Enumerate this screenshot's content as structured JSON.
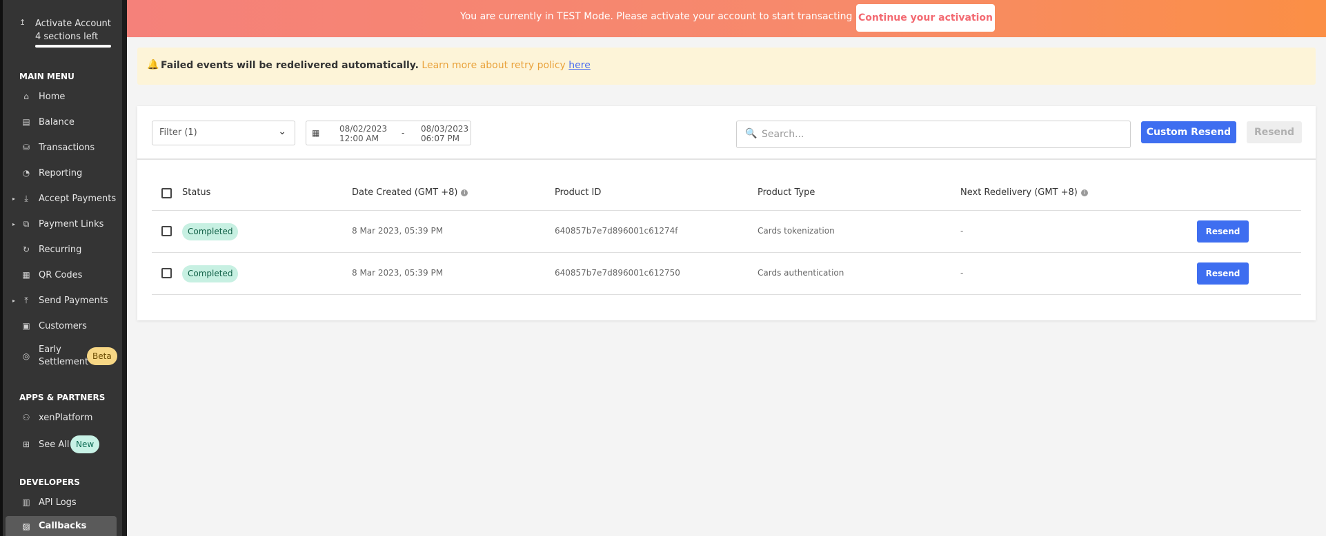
{
  "sidebar": {
    "activate": {
      "title": "Activate Account",
      "subtitle": "4 sections left",
      "progress": 1.0
    },
    "main_menu_title": "MAIN MENU",
    "items": [
      {
        "label": "Home",
        "icon": "home-icon"
      },
      {
        "label": "Balance",
        "icon": "balance-icon"
      },
      {
        "label": "Transactions",
        "icon": "transactions-icon"
      },
      {
        "label": "Reporting",
        "icon": "reporting-icon"
      },
      {
        "label": "Accept Payments",
        "icon": "accept-payments-icon"
      },
      {
        "label": "Payment Links",
        "icon": "link-icon"
      },
      {
        "label": "Recurring",
        "icon": "recurring-icon"
      },
      {
        "label": "QR Codes",
        "icon": "qr-code-icon"
      },
      {
        "label": "Send Payments",
        "icon": "send-payments-icon"
      },
      {
        "label": "Customers",
        "icon": "customers-icon"
      },
      {
        "label_line1": "Early",
        "label_line2": "Settlement",
        "badge": "Beta",
        "icon": "early-settlement-icon"
      }
    ],
    "apps_title": "APPS & PARTNERS",
    "apps": [
      {
        "label": "xenPlatform",
        "icon": "people-icon"
      },
      {
        "label": "See All",
        "badge": "New",
        "icon": "grid-icon"
      }
    ],
    "dev_title": "DEVELOPERS",
    "dev": [
      {
        "label": "API Logs",
        "icon": "api-logs-icon"
      },
      {
        "label": "Callbacks",
        "icon": "callbacks-icon",
        "active": true
      }
    ]
  },
  "banner": {
    "message": "You are currently in TEST Mode. Please activate your account to start transacting live.",
    "cta": "Continue your activation"
  },
  "notice": {
    "bold": "Failed events will be redelivered automatically.",
    "soft": "Learn more about retry policy",
    "link": "here"
  },
  "toolbar": {
    "filter": "Filter (1)",
    "date_from": {
      "date": "08/02/2023",
      "time": "12:00 AM"
    },
    "separator": "-",
    "date_to": {
      "date": "08/03/2023",
      "time": "06:07 PM"
    },
    "search_placeholder": "Search...",
    "custom_resend": "Custom Resend",
    "resend": "Resend"
  },
  "table": {
    "columns": {
      "status": "Status",
      "date_created": "Date Created (GMT +8)",
      "product_id": "Product ID",
      "product_type": "Product Type",
      "next_redelivery": "Next Redelivery (GMT +8)"
    },
    "rows": [
      {
        "status": "Completed",
        "date": "8 Mar 2023, 05:39 PM",
        "product_id": "640857b7e7d896001c61274f",
        "product_type": "Cards tokenization",
        "next": "-",
        "action": "Resend"
      },
      {
        "status": "Completed",
        "date": "8 Mar 2023, 05:39 PM",
        "product_id": "640857b7e7d896001c612750",
        "product_type": "Cards authentication",
        "next": "-",
        "action": "Resend"
      }
    ]
  }
}
